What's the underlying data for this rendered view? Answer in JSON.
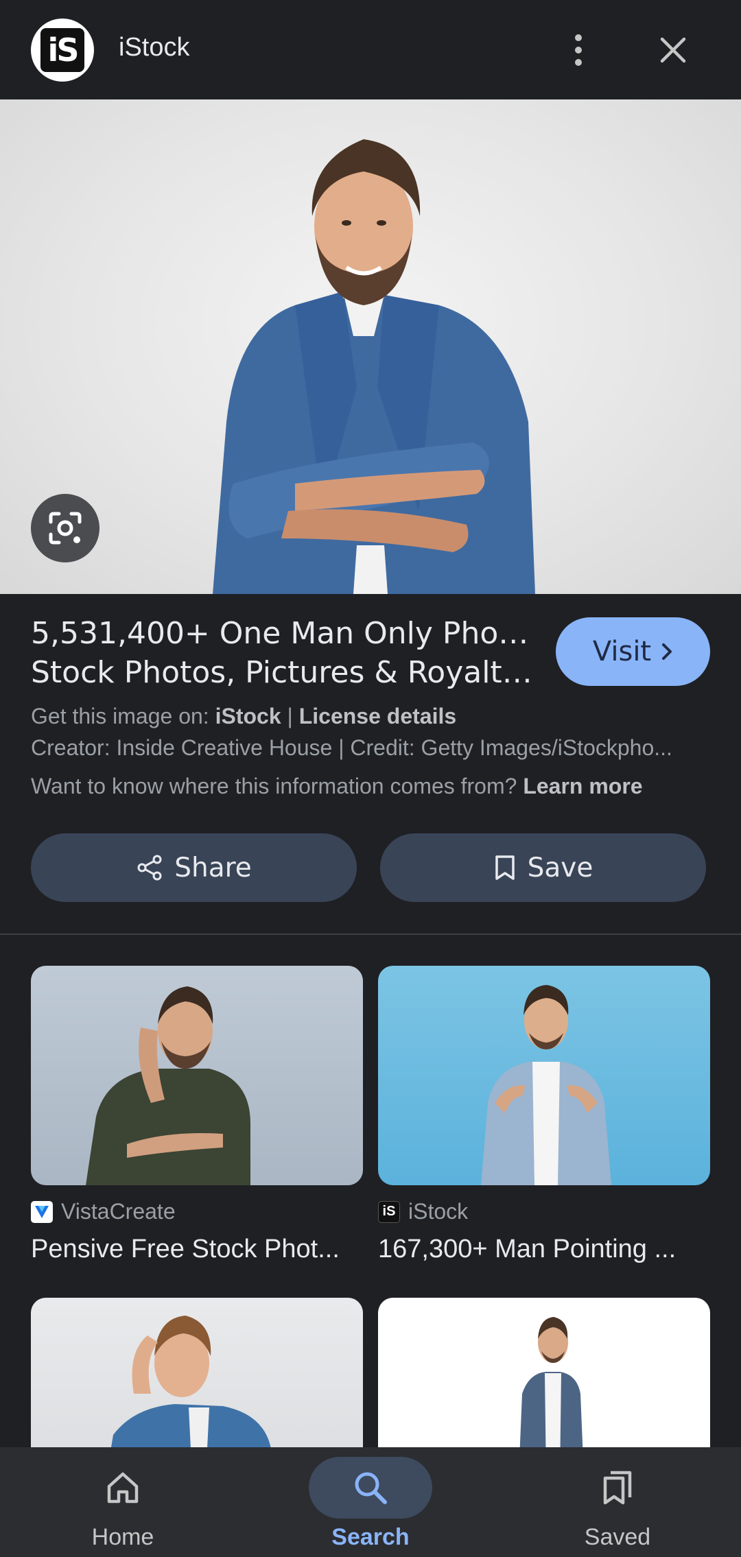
{
  "header": {
    "logo_text": "iS",
    "site_name": "iStock"
  },
  "result": {
    "title_line1": "5,531,400+ One Man Only Photos",
    "title_line2": "Stock Photos, Pictures & Royalty ...",
    "visit_label": "Visit",
    "get_image_prefix": "Get this image on: ",
    "get_image_source": "iStock",
    "separator": " | ",
    "license_label": "License details",
    "credit_line": "Creator: Inside Creative House | Credit: Getty Images/iStockpho...",
    "info_question": "Want to know where this information comes from? ",
    "learn_more": "Learn more",
    "share_label": "Share",
    "save_label": "Save"
  },
  "related": [
    {
      "source": "VistaCreate",
      "title": "Pensive Free Stock Phot..."
    },
    {
      "source": "iStock",
      "title": "167,300+ Man Pointing ..."
    }
  ],
  "nav": {
    "home": "Home",
    "search": "Search",
    "saved": "Saved"
  },
  "colors": {
    "background": "#1f2024",
    "accent": "#8ab4f8",
    "button": "#394457"
  }
}
